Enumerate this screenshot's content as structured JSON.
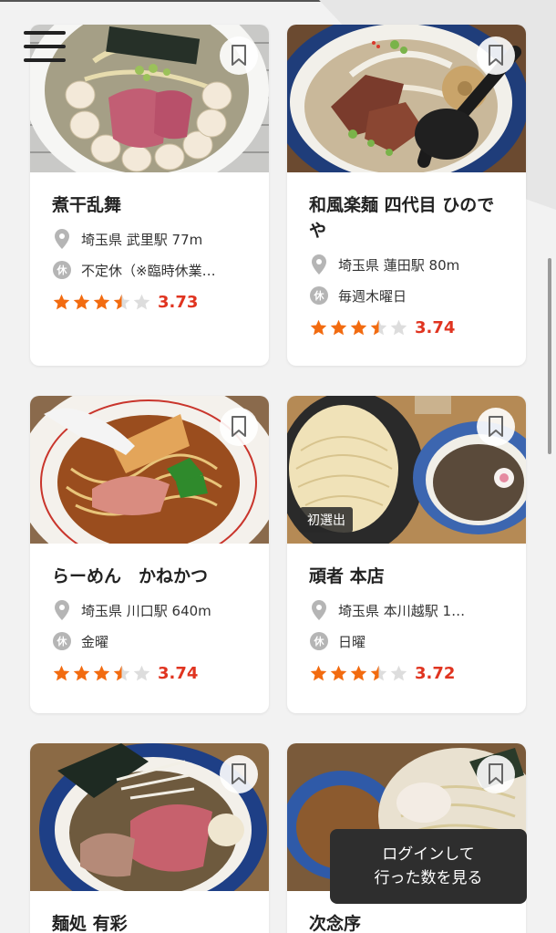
{
  "menu": {
    "icon": "hamburger-menu-icon"
  },
  "shops": [
    {
      "name": "煮干乱舞",
      "location": "埼玉県 武里駅 77m",
      "holiday": "不定休（※臨時休業…",
      "rating": 3.5,
      "score": "3.73",
      "badge": ""
    },
    {
      "name": "和風楽麺 四代目 ひのでや",
      "location": "埼玉県 蓮田駅 80m",
      "holiday": "毎週木曜日",
      "rating": 3.5,
      "score": "3.74",
      "badge": ""
    },
    {
      "name": "らーめん　かねかつ",
      "location": "埼玉県 川口駅 640m",
      "holiday": "金曜",
      "rating": 3.5,
      "score": "3.74",
      "badge": ""
    },
    {
      "name": "頑者 本店",
      "location": "埼玉県 本川越駅 1…",
      "holiday": "日曜",
      "rating": 3.5,
      "score": "3.72",
      "badge": "初選出"
    },
    {
      "name": "麺処 有彩",
      "location": "",
      "holiday": "",
      "rating": 0,
      "score": "",
      "badge": ""
    },
    {
      "name": "次念序",
      "location": "",
      "holiday": "",
      "rating": 0,
      "score": "",
      "badge": ""
    }
  ],
  "labels": {
    "holiday_icon": "休"
  },
  "login_popup": {
    "line1": "ログインして",
    "line2": "行った数を見る"
  },
  "colors": {
    "star": "#f26b10",
    "score": "#e03420",
    "background": "#f2f2f2"
  }
}
